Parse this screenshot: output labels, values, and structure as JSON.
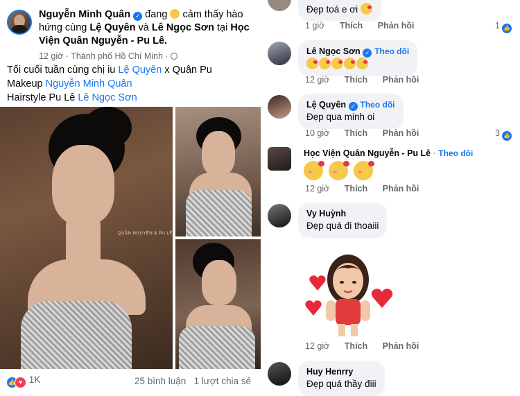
{
  "post": {
    "author": "Nguyễn Minh Quân",
    "feeling_word": "đang",
    "feeling_text": "cảm thấy hào hứng cùng",
    "tag1": "Lệ Quyên",
    "and_word": "và",
    "tag2": "Lê Ngọc Sơn",
    "at_word": "tại",
    "place": "Học Viện Quân Nguyễn - Pu Lê.",
    "time": "12 giờ",
    "location": "Thành phố Hồ Chí Minh",
    "caption_line1_a": "Tối cuối tuần cùng chị iu",
    "caption_line1_tag": "Lệ Quyên",
    "caption_line1_b": "x Quân Pu",
    "caption_line2_a": "Makeup",
    "caption_line2_tag": "Nguyễn Minh Quân",
    "caption_line3_a": "Hairstyle Pu Lê",
    "caption_line3_tag": "Lê Ngọc Sơn",
    "watermark": "QUÂN NGUYỄN & PU LÊ",
    "reactions_count": "1K",
    "comments_count": "25 bình luận",
    "shares_count": "1 lượt chia sẻ"
  },
  "comments": [
    {
      "name": "",
      "text": "Đẹp toá e ơi",
      "time": "1 giờ",
      "like": "Thích",
      "reply": "Phản hồi",
      "likes": "1"
    },
    {
      "name": "Lê Ngọc Sơn",
      "follow": "Theo dõi",
      "text": "",
      "time": "12 giờ",
      "like": "Thích",
      "reply": "Phản hồi"
    },
    {
      "name": "Lệ Quyên",
      "follow": "Theo dõi",
      "text": "Đẹp qua minh oi",
      "time": "10 giờ",
      "like": "Thích",
      "reply": "Phản hồi",
      "likes": "3"
    },
    {
      "name": "Học Viện Quân Nguyễn - Pu Lê",
      "sep": "·",
      "follow": "Theo dõi",
      "time": "12 giờ",
      "like": "Thích",
      "reply": "Phản hồi"
    },
    {
      "name": "Vy Huỳnh",
      "text": "Đẹp quá đi thoaiii"
    },
    {
      "time": "12 giờ",
      "like": "Thích",
      "reply": "Phản hồi"
    },
    {
      "name": "Huy Henrry",
      "text": "Đẹp quá thầy điii"
    }
  ],
  "icons": {
    "verified": "verified-badge-icon",
    "globe": "globe-icon",
    "like": "like-icon",
    "heart": "heart-icon"
  },
  "colors": {
    "link": "#1877f2",
    "bubble": "#f0f2f5",
    "meta": "#65676b"
  }
}
